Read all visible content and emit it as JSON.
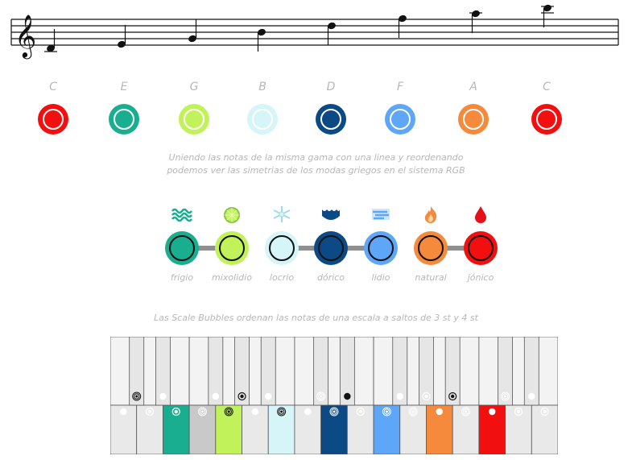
{
  "staff": {
    "clef": "treble-clef",
    "notes": [
      "C",
      "E",
      "G",
      "B",
      "D",
      "F",
      "A",
      "C"
    ]
  },
  "color_row": {
    "notes": [
      {
        "label": "C",
        "color": "#f20f0f"
      },
      {
        "label": "E",
        "color": "#1aae91"
      },
      {
        "label": "G",
        "color": "#c2f25a"
      },
      {
        "label": "B",
        "color": "#d6f5f9"
      },
      {
        "label": "D",
        "color": "#0b4a84"
      },
      {
        "label": "F",
        "color": "#5ea6f7"
      },
      {
        "label": "A",
        "color": "#f58a3c"
      },
      {
        "label": "C",
        "color": "#f20f0f"
      }
    ]
  },
  "caption1_line1": "Uniendo las notas de la misma gama con una linea y reordenando",
  "caption1_line2": "podemos ver las simetrias de los modas griegos en el sistema RGB",
  "modes": [
    {
      "label": "frigio",
      "color": "#1aae91",
      "icon": "water-waves-icon"
    },
    {
      "label": "mixolidio",
      "color": "#c2f25a",
      "icon": "lime-icon"
    },
    {
      "label": "locrio",
      "color": "#d6f5f9",
      "icon": "snowflake-icon"
    },
    {
      "label": "dórico",
      "color": "#0b4a84",
      "icon": "ocean-wave-icon"
    },
    {
      "label": "lidio",
      "color": "#5ea6f7",
      "icon": "wind-icon"
    },
    {
      "label": "natural",
      "color": "#f58a3c",
      "icon": "fire-icon"
    },
    {
      "label": "jónico",
      "color": "#f20f0f",
      "icon": "blood-drop-icon"
    }
  ],
  "caption2": "Las Scale Bubbles ordenan las notas de una escala a saltos de 3 st y 4 st",
  "piano": {
    "white_keys": [
      {
        "color": "#e9e9e9",
        "marker": "dot"
      },
      {
        "color": "#e9e9e9",
        "marker": "ring"
      },
      {
        "color": "#1aae91",
        "marker": "ring"
      },
      {
        "color": "#c9c9c9",
        "marker": "spiral"
      },
      {
        "color": "#c2f25a",
        "marker": "spiral"
      },
      {
        "color": "#e9e9e9",
        "marker": "dot"
      },
      {
        "color": "#d6f5f9",
        "marker": "spiral"
      },
      {
        "color": "#e9e9e9",
        "marker": "dot"
      },
      {
        "color": "#0b4a84",
        "marker": "spiral"
      },
      {
        "color": "#e9e9e9",
        "marker": "ring"
      },
      {
        "color": "#5ea6f7",
        "marker": "spiral"
      },
      {
        "color": "#e9e9e9",
        "marker": "spiral"
      },
      {
        "color": "#f58a3c",
        "marker": "dot"
      },
      {
        "color": "#e9e9e9",
        "marker": "spiral"
      },
      {
        "color": "#f20f0f",
        "marker": "dot"
      },
      {
        "color": "#e9e9e9",
        "marker": "ring"
      },
      {
        "color": "#e9e9e9",
        "marker": "ring"
      }
    ],
    "black_keys": [
      {
        "marker": "spiral"
      },
      {
        "marker": "dot"
      },
      {
        "marker": "dot"
      },
      {
        "marker": "ring"
      },
      {
        "marker": "dot"
      },
      {
        "marker": "spiral"
      },
      {
        "marker": "dot"
      },
      {
        "marker": "dot"
      },
      {
        "marker": "ring"
      },
      {
        "marker": "ring"
      },
      {
        "marker": "spiral"
      },
      {
        "marker": "dot"
      }
    ]
  }
}
